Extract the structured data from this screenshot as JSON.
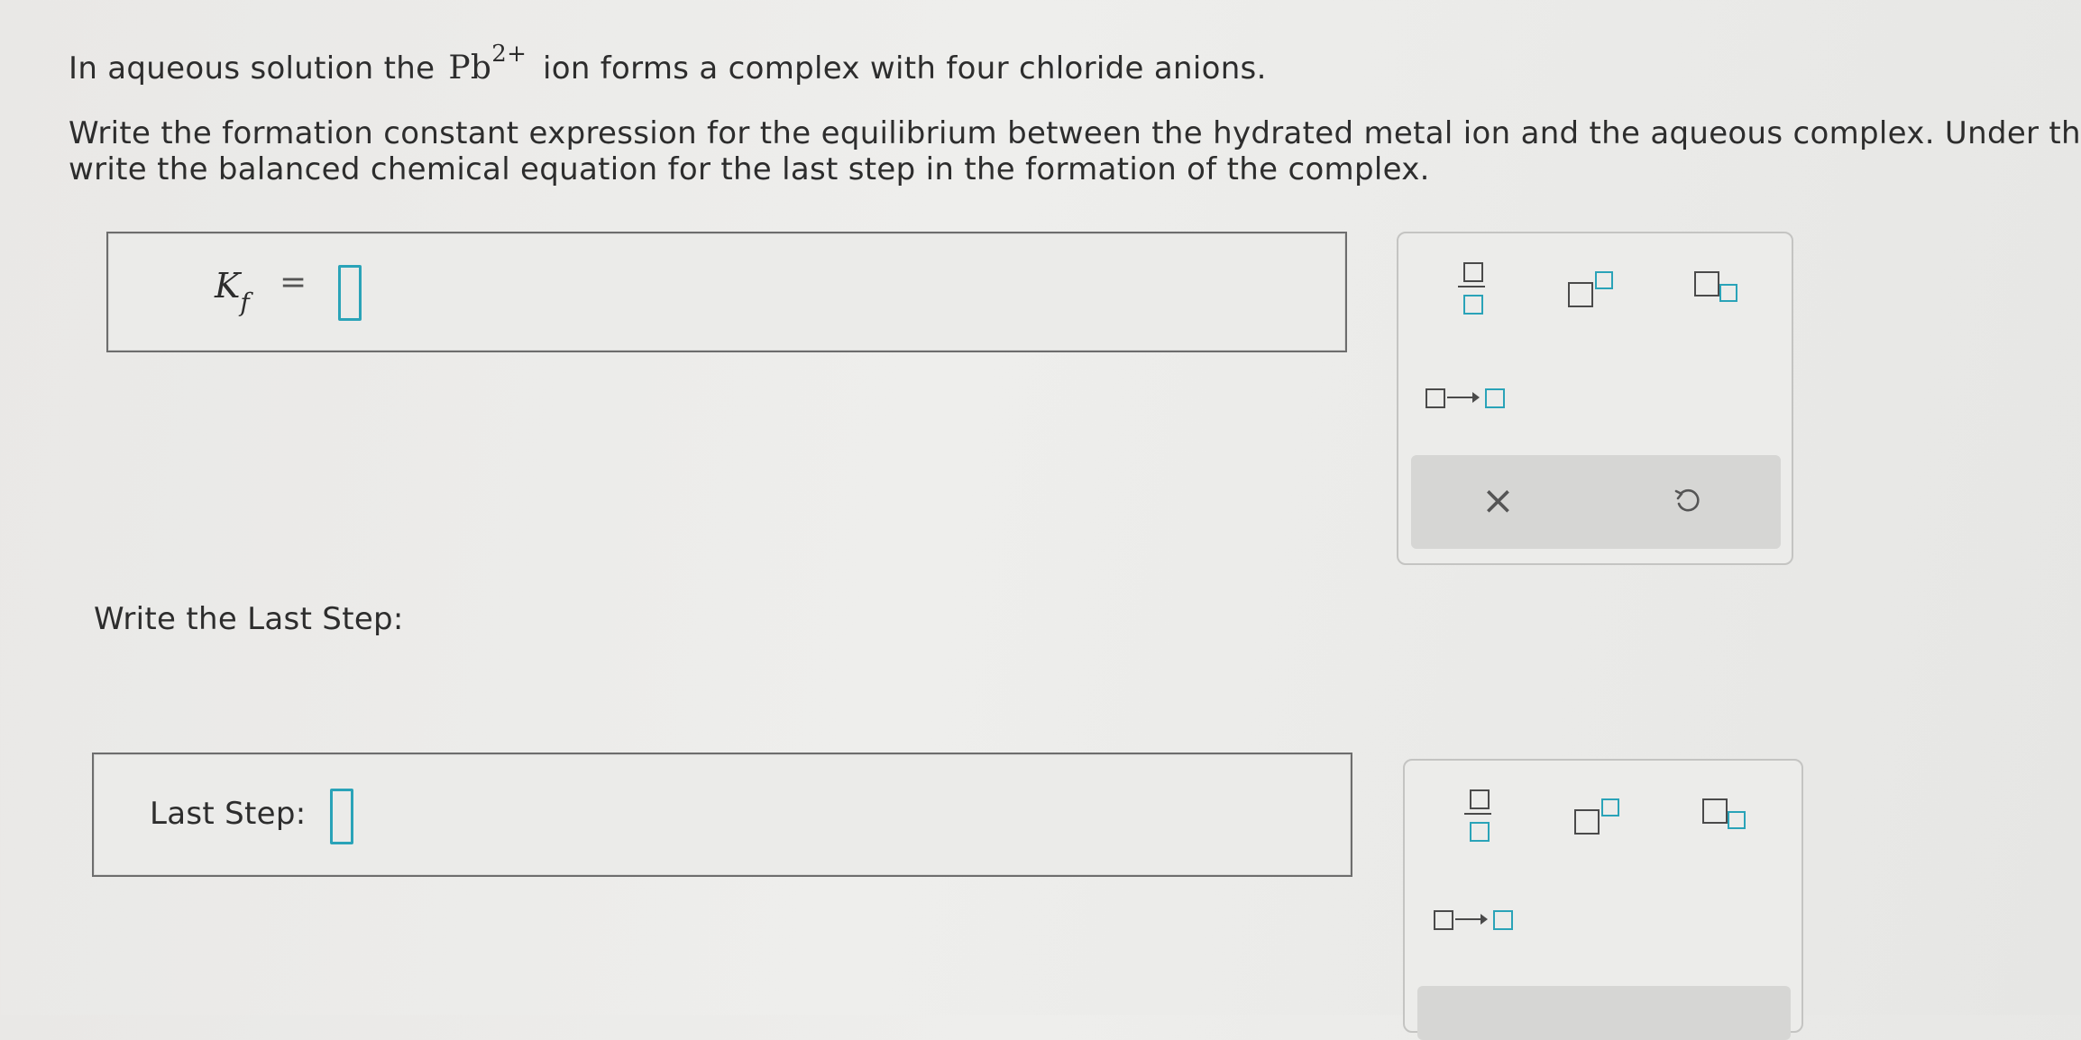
{
  "question": {
    "line1_prefix": "In aqueous solution the",
    "ion_base": "Pb",
    "ion_charge": "2+",
    "line1_suffix": "ion forms a complex with four chloride anions.",
    "para2_line1": "Write the formation constant expression for the equilibrium between the hydrated metal ion and the aqueous complex. Under that,",
    "para2_line2": "write the balanced chemical equation for the last step in the formation of the complex."
  },
  "kf_answer": {
    "label_main": "K",
    "label_sub": "f",
    "equals": "=",
    "value": ""
  },
  "last_step_heading": "Write the Last Step:",
  "last_step_answer": {
    "label": "Last Step:",
    "value": ""
  },
  "palettes": [
    {
      "tools": [
        "fraction-template",
        "superscript-template",
        "subscript-template",
        "reaction-arrow-template"
      ],
      "actions": [
        "clear-icon",
        "undo-icon"
      ]
    },
    {
      "tools": [
        "fraction-template",
        "superscript-template",
        "subscript-template",
        "reaction-arrow-template"
      ]
    }
  ],
  "colors": {
    "accent": "#2aa3b8",
    "border": "#6d6d6d",
    "background": "#ebebe9"
  }
}
